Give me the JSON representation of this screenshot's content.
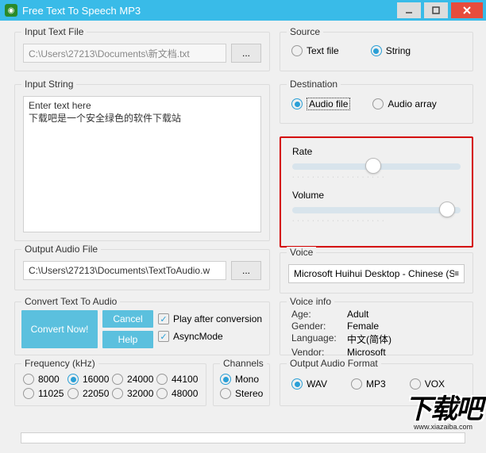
{
  "window": {
    "title": "Free Text To Speech MP3"
  },
  "inputFile": {
    "legend": "Input Text File",
    "path": "C:\\Users\\27213\\Documents\\新文档.txt",
    "browse": "..."
  },
  "inputString": {
    "legend": "Input String",
    "text": "Enter text here\n下载吧是一个安全绿色的软件下载站"
  },
  "outputFile": {
    "legend": "Output Audio File",
    "path": "C:\\Users\\27213\\Documents\\TextToAudio.w",
    "browse": "..."
  },
  "convert": {
    "legend": "Convert Text To Audio",
    "convert_label": "Convert Now!",
    "cancel_label": "Cancel",
    "help_label": "Help",
    "play_after_label": "Play after conversion",
    "play_after_checked": true,
    "async_label": "AsyncMode",
    "async_checked": true
  },
  "frequency": {
    "legend": "Frequency (kHz)",
    "options": [
      "8000",
      "16000",
      "24000",
      "44100",
      "11025",
      "22050",
      "32000",
      "48000"
    ],
    "selected": "16000"
  },
  "channels": {
    "legend": "Channels",
    "options": [
      "Mono",
      "Stereo"
    ],
    "selected": "Mono"
  },
  "source": {
    "legend": "Source",
    "options": [
      "Text file",
      "String"
    ],
    "selected": "String"
  },
  "destination": {
    "legend": "Destination",
    "options": [
      "Audio file",
      "Audio array"
    ],
    "selected": "Audio file"
  },
  "rate": {
    "legend": "Rate",
    "value_pct": 48
  },
  "volume": {
    "legend": "Volume",
    "value_pct": 92
  },
  "voice": {
    "legend": "Voice",
    "selected": "Microsoft Huihui Desktop - Chinese (Sir"
  },
  "voiceInfo": {
    "legend": "Voice info",
    "age_label": "Age:",
    "age_value": "Adult",
    "gender_label": "Gender:",
    "gender_value": "Female",
    "language_label": "Language:",
    "language_value": "中文(简体)",
    "vendor_label": "Vendor:",
    "vendor_value": "Microsoft"
  },
  "outputFormat": {
    "legend": "Output Audio Format",
    "options": [
      "WAV",
      "MP3",
      "VOX"
    ],
    "selected": "WAV"
  },
  "watermark": {
    "big": "下载吧",
    "url": "www.xiazaiba.com"
  }
}
